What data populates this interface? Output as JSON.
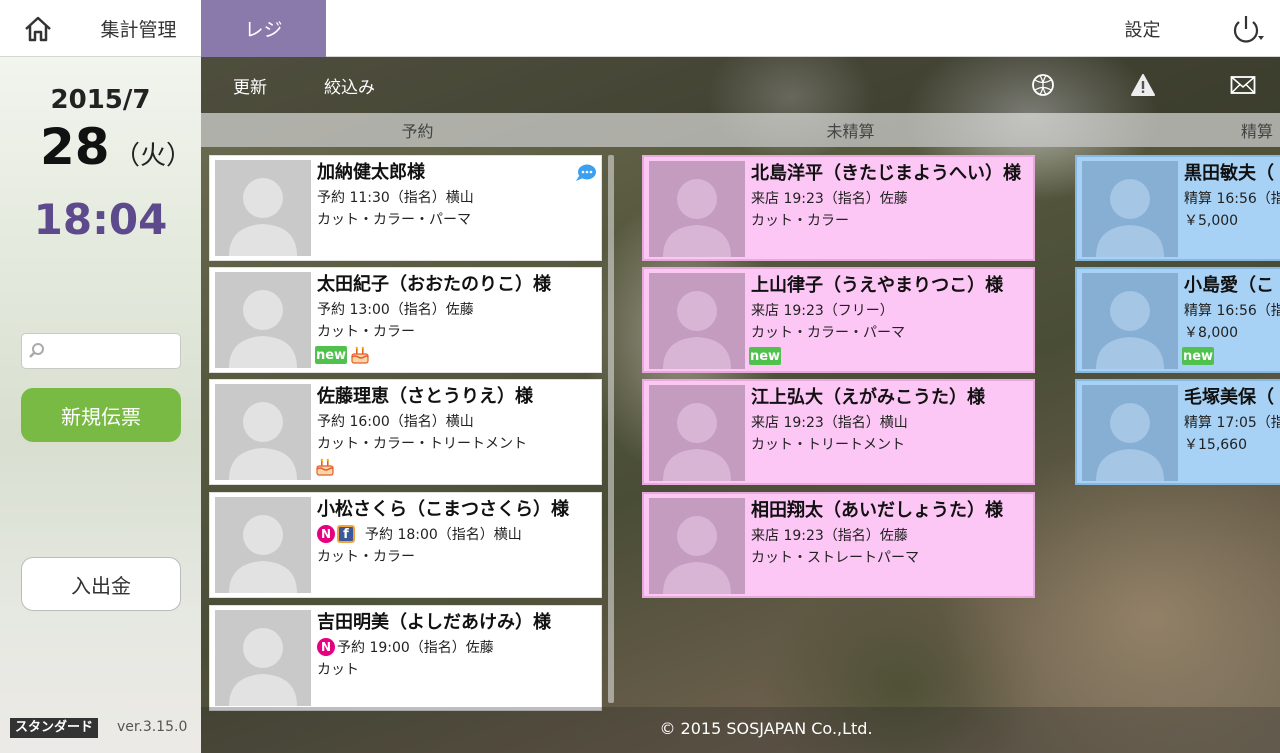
{
  "nav": {
    "aggregate": "集計管理",
    "register": "レジ",
    "settings": "設定"
  },
  "sidebar": {
    "year_month": "2015/7",
    "day": "28",
    "weekday": "（火）",
    "time": "18:04",
    "search_placeholder": "",
    "new_slip": "新規伝票",
    "cash_in_out": "入出金",
    "edition": "スタンダード",
    "version": "ver.3.15.0"
  },
  "toolbar": {
    "refresh": "更新",
    "filter": "絞込み"
  },
  "columns": {
    "reservation": "予約",
    "unsettled": "未精算",
    "settled": "精算"
  },
  "reservations": [
    {
      "name": "加納健太郎様",
      "line1": "予約 11:30（指名）横山",
      "line2": "カット・カラー・パーマ"
    },
    {
      "name": "太田紀子（おおたのりこ）様",
      "line1": "予約 13:00（指名）佐藤",
      "line2": "カット・カラー",
      "badge_new": "new"
    },
    {
      "name": "佐藤理恵（さとうりえ）様",
      "line1": "予約 16:00（指名）横山",
      "line2": "カット・カラー・トリートメント"
    },
    {
      "name": "小松さくら（こまつさくら）様",
      "n_badge": "N",
      "fb_badge": "f",
      "line1": "予約 18:00（指名）横山",
      "line2": "カット・カラー"
    },
    {
      "name": "吉田明美（よしだあけみ）様",
      "n_badge": "N",
      "line1": "予約 19:00（指名）佐藤",
      "line2": "カット"
    }
  ],
  "unsettled": [
    {
      "name": "北島洋平（きたじまようへい）様",
      "line1": "来店 19:23（指名）佐藤",
      "line2": "カット・カラー"
    },
    {
      "name": "上山律子（うえやまりつこ）様",
      "line1": "来店 19:23（フリー）",
      "line2": "カット・カラー・パーマ",
      "badge_new": "new"
    },
    {
      "name": "江上弘大（えがみこうた）様",
      "line1": "来店 19:23（指名）横山",
      "line2": "カット・トリートメント"
    },
    {
      "name": "相田翔太（あいだしょうた）様",
      "line1": "来店 19:23（指名）佐藤",
      "line2": "カット・ストレートパーマ"
    }
  ],
  "settled": [
    {
      "name": "黒田敏夫（",
      "line1": "精算 16:56（指",
      "line2": "￥5,000"
    },
    {
      "name": "小島愛（こ",
      "line1": "精算 16:56（指",
      "line2": "￥8,000",
      "badge_new": "new"
    },
    {
      "name": "毛塚美保（",
      "line1": "精算 17:05（指",
      "line2": "￥15,660"
    }
  ],
  "footer": {
    "copyright": "© 2015 SOSJAPAN Co.,Ltd."
  },
  "colors": {
    "accent_purple": "#8a7aac",
    "time_purple": "#5c4a8c",
    "new_green": "#79ba45",
    "unsettled_pink": "#fcc6f5",
    "settled_blue": "#a8d2f5"
  }
}
